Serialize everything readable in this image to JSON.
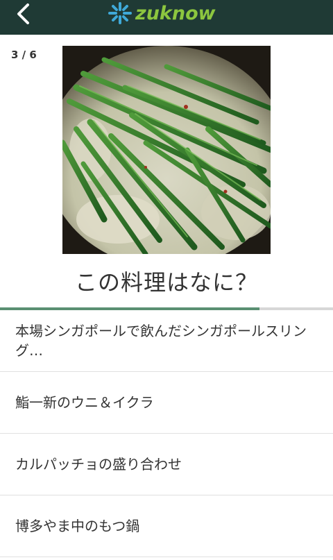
{
  "header": {
    "back_icon": "chevron-left-icon",
    "logo_text": "zuknow",
    "logo_icon": "asterisk-star-icon",
    "background_color": "#1f3a35",
    "logo_color": "#8cc63f"
  },
  "quiz": {
    "counter": "3 / 6",
    "question": "この料理はなに？",
    "progress_fraction": 0.78,
    "image_description_icon": "food-photo"
  },
  "options": [
    {
      "label": "本場シンガポールで飲んだシンガポールスリング…"
    },
    {
      "label": "鮨一新のウニ＆イクラ"
    },
    {
      "label": "カルパッチョの盛り合わせ"
    },
    {
      "label": "博多やま中のもつ鍋"
    }
  ]
}
